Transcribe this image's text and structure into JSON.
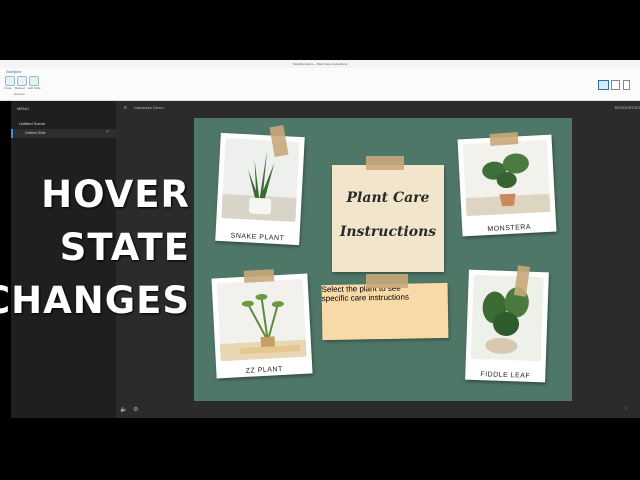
{
  "window": {
    "title": "Storyline Demo – Plant Care Instructions"
  },
  "ribbon": {
    "tab": "Storyline",
    "buttons": [
      {
        "label": "Close"
      },
      {
        "label": "Reload"
      },
      {
        "label": "Edit Slide"
      }
    ],
    "group_label": "Preview"
  },
  "menu": {
    "header": "MENU",
    "scene_title": "Untitled Scene",
    "slide_title": "Untitled Slide"
  },
  "topbar": {
    "course_name": "Galvanize Demo",
    "resources": "RESOURCES"
  },
  "slide": {
    "title_note": {
      "line1": "Plant Care",
      "line2": "Instructions"
    },
    "instructions_note": {
      "line1": "Select the plant to see",
      "line2": "specific care instructions"
    },
    "plants": [
      {
        "label": "SNAKE PLANT"
      },
      {
        "label": "MONSTERA"
      },
      {
        "label": "ZZ PLANT"
      },
      {
        "label": "FIDDLE LEAF"
      }
    ]
  },
  "overlay": {
    "line1": "HOVER",
    "line2": "STATE",
    "line3": "CHANGES"
  },
  "colors": {
    "board": "#4f7768",
    "note": "#f3e5cc",
    "tape": "#c8a97a",
    "accent": "#3a8ee6"
  },
  "icons": [
    "volume-icon",
    "settings-icon",
    "hamburger-icon",
    "checkmark-icon"
  ]
}
